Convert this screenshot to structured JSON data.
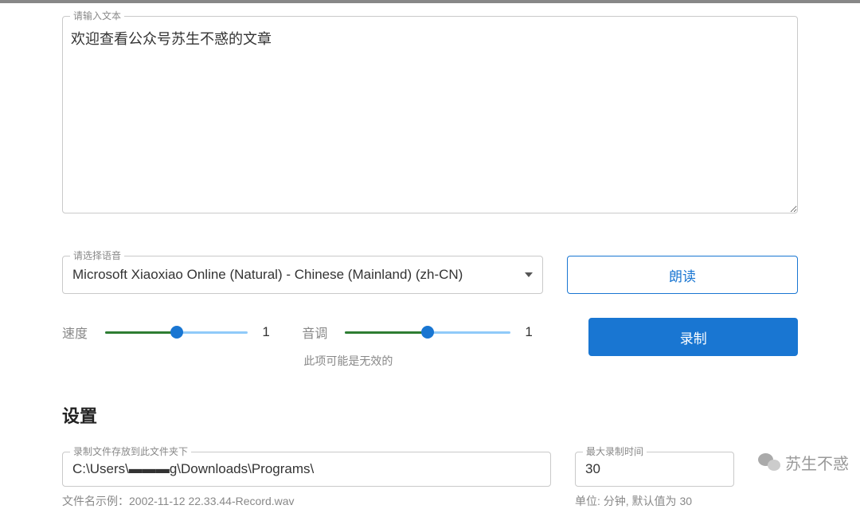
{
  "text_input": {
    "label": "请输入文本",
    "value": "欢迎查看公众号苏生不惑的文章"
  },
  "voice": {
    "label": "请选择语音",
    "selected": "Microsoft Xiaoxiao Online (Natural) - Chinese (Mainland) (zh-CN)"
  },
  "buttons": {
    "read": "朗读",
    "record": "录制"
  },
  "speed": {
    "label": "速度",
    "value": "1"
  },
  "pitch": {
    "label": "音调",
    "value": "1",
    "hint": "此项可能是无效的"
  },
  "settings": {
    "title": "设置",
    "save_path": {
      "label": "录制文件存放到此文件夹下",
      "value": "C:\\Users\\▬▬▬g\\Downloads\\Programs\\",
      "hint": "文件名示例：2002-11-12 22.33.44-Record.wav"
    },
    "max_time": {
      "label": "最大录制时间",
      "value": "30",
      "hint": "单位: 分钟, 默认值为 30"
    }
  },
  "watermark": "苏生不惑"
}
